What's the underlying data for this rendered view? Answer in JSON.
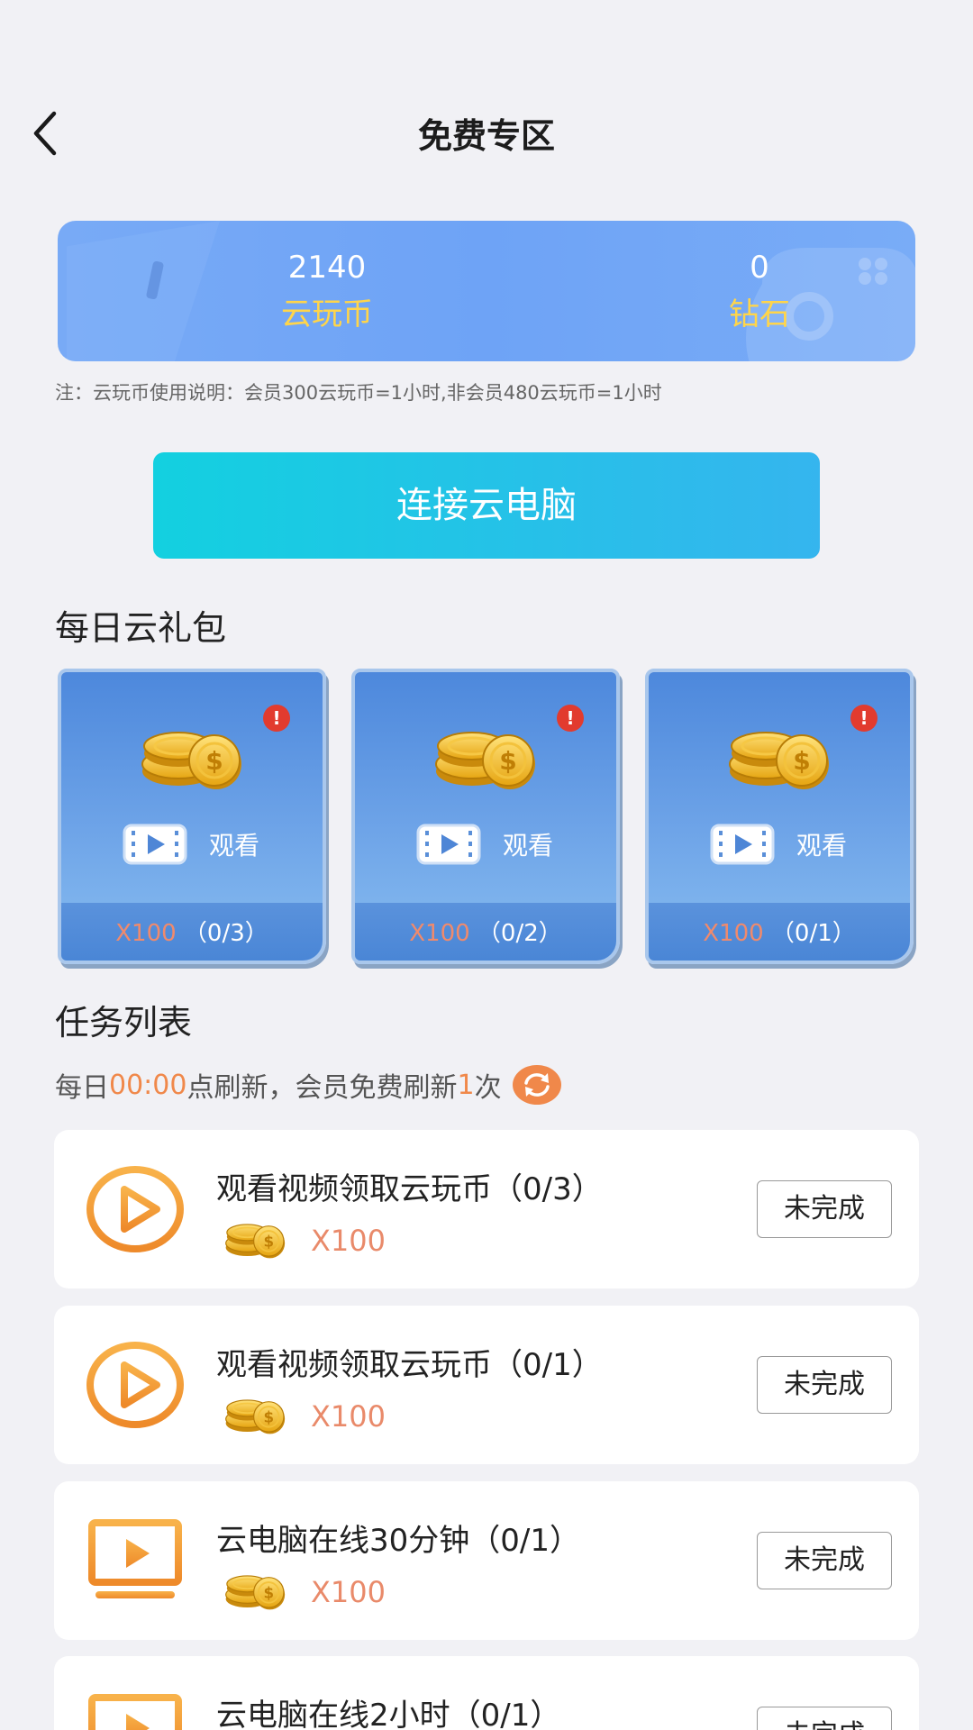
{
  "header": {
    "title": "免费专区"
  },
  "balance": {
    "coins_value": "2140",
    "coins_label": "云玩币",
    "diamonds_value": "0",
    "diamonds_label": "钻石"
  },
  "note": "注：云玩币使用说明：会员300云玩币=1小时,非会员480云玩币=1小时",
  "connect_button": "连接云电脑",
  "daily_gift": {
    "title": "每日云礼包",
    "cards": [
      {
        "badge": "!",
        "watch_label": "观看",
        "reward": "X100",
        "progress": "（0/3）"
      },
      {
        "badge": "!",
        "watch_label": "观看",
        "reward": "X100",
        "progress": "（0/2）"
      },
      {
        "badge": "!",
        "watch_label": "观看",
        "reward": "X100",
        "progress": "（0/1）"
      }
    ]
  },
  "tasks": {
    "title": "任务列表",
    "refresh": {
      "prefix": "每日",
      "time": "00:00",
      "middle": "点刷新，会员免费刷新",
      "count": "1",
      "suffix": "次"
    },
    "items": [
      {
        "icon": "play-circle-icon",
        "title": "观看视频领取云玩币（0/3）",
        "reward": "X100",
        "status": "未完成"
      },
      {
        "icon": "play-circle-icon",
        "title": "观看视频领取云玩币（0/1）",
        "reward": "X100",
        "status": "未完成"
      },
      {
        "icon": "monitor-play-icon",
        "title": "云电脑在线30分钟（0/1）",
        "reward": "X100",
        "status": "未完成"
      },
      {
        "icon": "monitor-play-icon",
        "title": "云电脑在线2小时（0/1）",
        "reward": "",
        "status": "未完成"
      }
    ]
  },
  "colors": {
    "accent_orange": "#f0884a",
    "card_blue": "#6ea3f6",
    "button_cyan": "#13d0e0"
  }
}
